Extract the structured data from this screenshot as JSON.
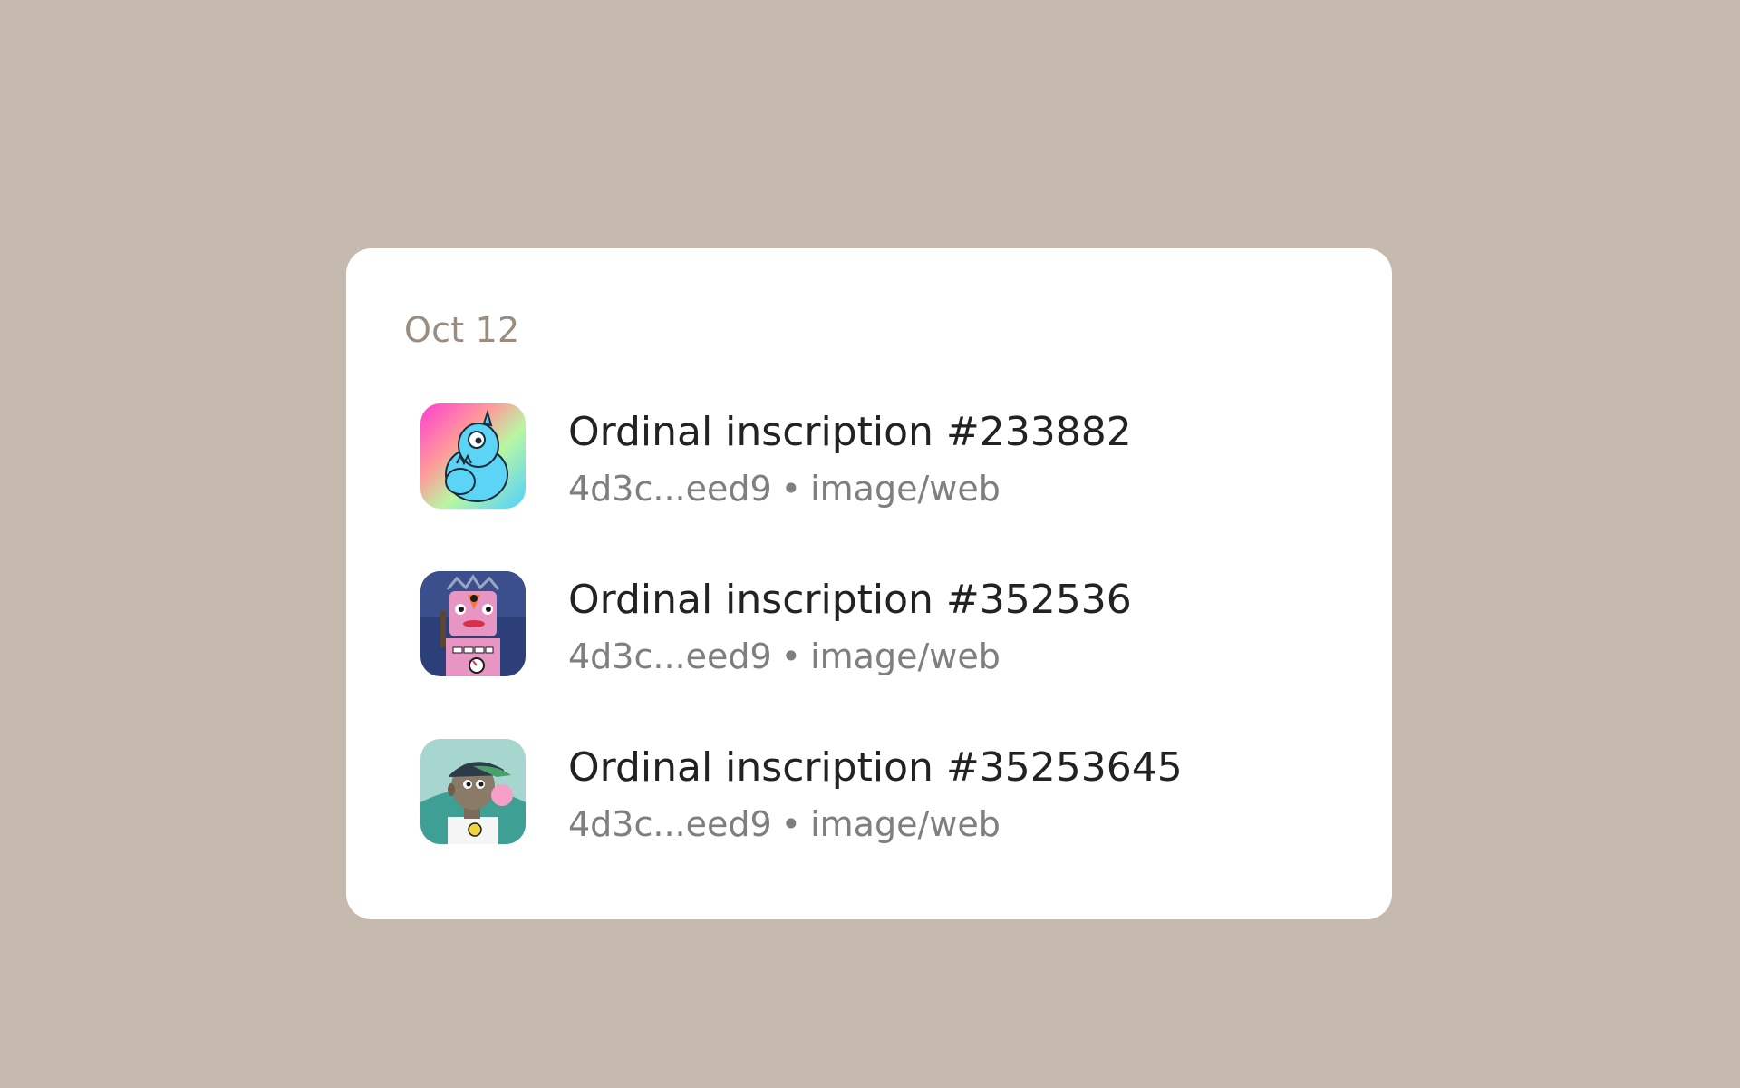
{
  "activity": {
    "date_label": "Oct 12",
    "items": [
      {
        "title": "Ordinal inscription #233882",
        "hash": "4d3c...eed9",
        "separator": "•",
        "type": "image/web",
        "thumbnail_icon": "blue-monster-nft-icon"
      },
      {
        "title": "Ordinal inscription #352536",
        "hash": "4d3c...eed9",
        "separator": "•",
        "type": "image/web",
        "thumbnail_icon": "pink-robot-nft-icon"
      },
      {
        "title": "Ordinal inscription #35253645",
        "hash": "4d3c...eed9",
        "separator": "•",
        "type": "image/web",
        "thumbnail_icon": "bubblegum-character-nft-icon"
      }
    ]
  },
  "colors": {
    "page_background": "#c6baae",
    "card_background": "#ffffff",
    "date_label": "#9a8c7e",
    "title_text": "#222222",
    "meta_text": "#7f7f7f"
  }
}
